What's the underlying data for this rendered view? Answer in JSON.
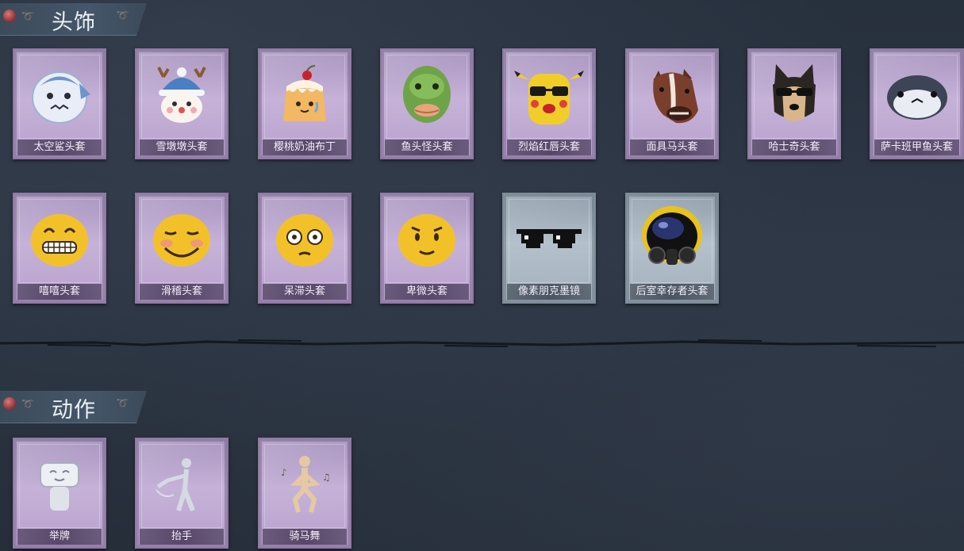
{
  "sections": {
    "headwear": {
      "title": "头饰",
      "items": [
        {
          "label": "太空鲨头套",
          "icon": "shark-helmet-icon",
          "rarity": "purple"
        },
        {
          "label": "雪墩墩头套",
          "icon": "snow-reindeer-helmet-icon",
          "rarity": "purple"
        },
        {
          "label": "樱桃奶油布丁",
          "icon": "cherry-pudding-icon",
          "rarity": "purple"
        },
        {
          "label": "鱼头怪头套",
          "icon": "fish-head-mask-icon",
          "rarity": "purple"
        },
        {
          "label": "烈焰红唇头套",
          "icon": "yellow-creature-sunglasses-icon",
          "rarity": "purple"
        },
        {
          "label": "面具马头套",
          "icon": "horse-mask-icon",
          "rarity": "purple"
        },
        {
          "label": "哈士奇头套",
          "icon": "husky-mask-icon",
          "rarity": "purple"
        },
        {
          "label": "萨卡班甲鱼头套",
          "icon": "fish-hood-icon",
          "rarity": "purple"
        },
        {
          "label": "嘻嘻头套",
          "icon": "grin-emoji-icon",
          "rarity": "purple"
        },
        {
          "label": "滑稽头套",
          "icon": "smirk-emoji-icon",
          "rarity": "purple"
        },
        {
          "label": "呆滞头套",
          "icon": "dazed-emoji-icon",
          "rarity": "purple"
        },
        {
          "label": "卑微头套",
          "icon": "timid-emoji-icon",
          "rarity": "purple"
        },
        {
          "label": "像素朋克墨镜",
          "icon": "pixel-sunglasses-icon",
          "rarity": "gray"
        },
        {
          "label": "后室幸存者头套",
          "icon": "gas-mask-helmet-icon",
          "rarity": "gray"
        }
      ]
    },
    "actions": {
      "title": "动作",
      "items": [
        {
          "label": "举牌",
          "icon": "hold-sign-pose-icon",
          "rarity": "purple"
        },
        {
          "label": "抬手",
          "icon": "raise-hand-pose-icon",
          "rarity": "purple"
        },
        {
          "label": "骑马舞",
          "icon": "horse-dance-pose-icon",
          "rarity": "purple"
        }
      ]
    }
  },
  "colors": {
    "background": "#2a3240",
    "purple_card": "#b9a2ce",
    "gray_card": "#a4b1bd",
    "header_bar": "#45566a"
  }
}
